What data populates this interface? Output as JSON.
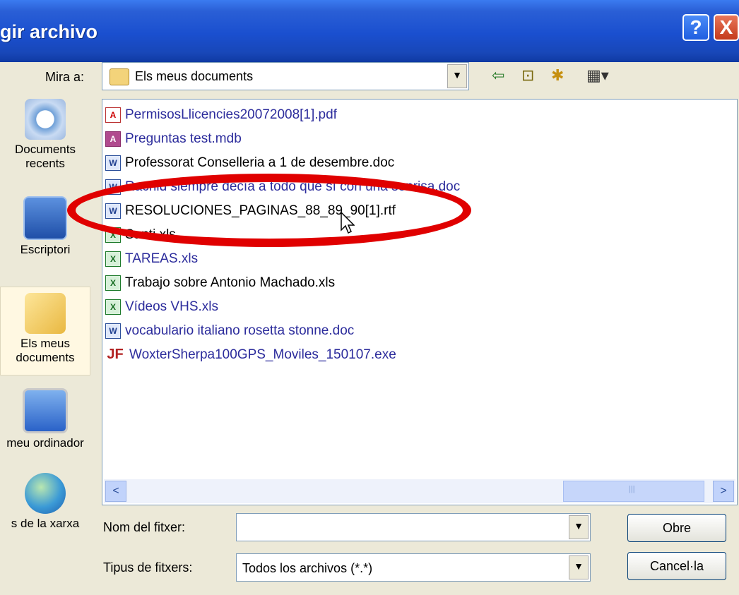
{
  "window": {
    "title": "gir archivo",
    "help_glyph": "?",
    "close_glyph": "X"
  },
  "lookin": {
    "label": "Mira a:",
    "value": "Els meus documents",
    "dropdown_glyph": "▼"
  },
  "toolbar": {
    "back_glyph": "⇦",
    "up_glyph": "⊡",
    "newfolder_glyph": "✱",
    "view_glyph": "▦▾"
  },
  "places": [
    {
      "label_line1": "Documents",
      "label_line2": "recents"
    },
    {
      "label_line1": "Escriptori",
      "label_line2": ""
    },
    {
      "label_line1": "Els meus",
      "label_line2": "documents"
    },
    {
      "label_line1": "meu ordinador",
      "label_line2": ""
    },
    {
      "label_line1": "s de la xarxa",
      "label_line2": ""
    }
  ],
  "files": [
    {
      "name": "PermisosLlicencies20072008[1].pdf",
      "type": "pdf",
      "icon_text": "A"
    },
    {
      "name": "Preguntas test.mdb",
      "type": "mdb",
      "icon_text": "A"
    },
    {
      "name": "Professorat Conselleria a 1 de desembre.doc",
      "type": "doc",
      "icon_text": "W"
    },
    {
      "name": "Rachid siempre decía a todo que sí con una sonrisa.doc",
      "type": "doc",
      "icon_text": "W"
    },
    {
      "name": "RESOLUCIONES_PAGINAS_88_89_90[1].rtf",
      "type": "doc",
      "icon_text": "W"
    },
    {
      "name": "Santi.xls",
      "type": "xls",
      "icon_text": "X"
    },
    {
      "name": "TAREAS.xls",
      "type": "xls",
      "icon_text": "X"
    },
    {
      "name": "Trabajo sobre Antonio Machado.xls",
      "type": "xls",
      "icon_text": "X"
    },
    {
      "name": "Vídeos VHS.xls",
      "type": "xls",
      "icon_text": "X"
    },
    {
      "name": "vocabulario italiano rosetta stonne.doc",
      "type": "doc",
      "icon_text": "W"
    },
    {
      "name": "WoxterSherpa100GPS_Moviles_150107.exe",
      "type": "exe",
      "icon_text": "JF"
    }
  ],
  "scrollbar": {
    "left_glyph": "<",
    "right_glyph": ">",
    "grip": "|||"
  },
  "filename": {
    "label": "Nom del fitxer:",
    "value": "",
    "dropdown_glyph": "▼"
  },
  "filetype": {
    "label": "Tipus de fitxers:",
    "value": "Todos los archivos (*.*)",
    "dropdown_glyph": "▼"
  },
  "buttons": {
    "open": "Obre",
    "cancel": "Cancel·la"
  },
  "colors": {
    "title_blue": "#1a4fcf",
    "file_text": "#2c2c9c",
    "annotation_red": "#e00000",
    "dialog_bg": "#ece9d8"
  }
}
